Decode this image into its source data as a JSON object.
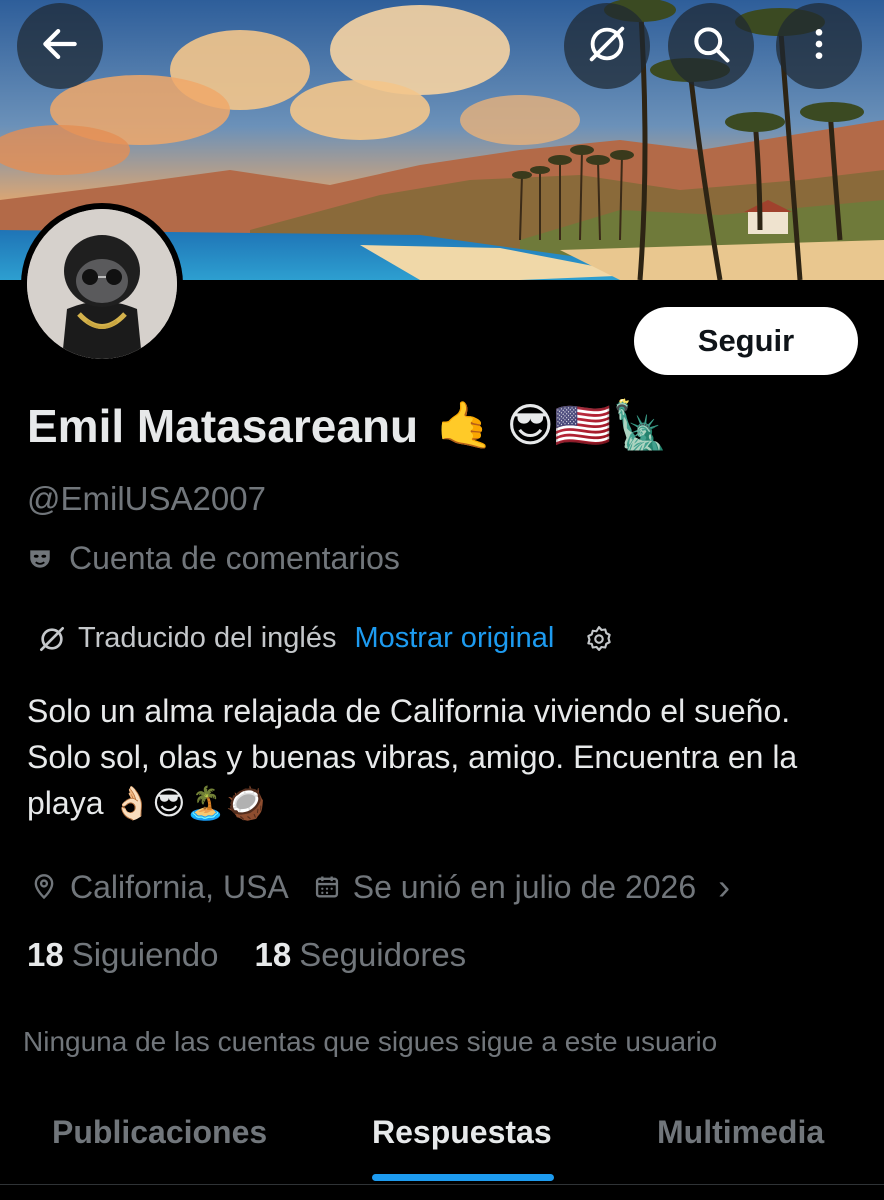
{
  "header": {
    "back_icon": "arrow-left-icon",
    "translate_icon": "translate-off-icon",
    "search_icon": "search-icon",
    "more_icon": "more-vertical-icon"
  },
  "profile": {
    "display_name": "Emil Matasareanu",
    "name_emojis": "🤙 😎🇺🇸🗽",
    "handle": "@EmilUSA2007",
    "account_label": "Cuenta de comentarios",
    "follow_label": "Seguir"
  },
  "translation": {
    "label": "Traducido del inglés",
    "show_original": "Mostrar original"
  },
  "bio": "Solo un alma relajada de California viviendo el sueño. Solo sol, olas y buenas vibras, amigo. Encuentra en la playa 👌🏻😎🏝️🥥",
  "meta": {
    "location": "California, USA",
    "joined": "Se unió en julio de 2026",
    "chevron": "›"
  },
  "stats": {
    "following_count": "18",
    "following_label": "Siguiendo",
    "followers_count": "18",
    "followers_label": "Seguidores"
  },
  "mutuals_note": "Ninguna de las cuentas que sigues sigue a este usuario",
  "tabs": [
    {
      "label": "Publicaciones"
    },
    {
      "label": "Respuestas",
      "active": true
    },
    {
      "label": "Multimedia"
    }
  ],
  "colors": {
    "accent": "#1d9bf0",
    "background": "#000000",
    "muted_text": "#71767b",
    "primary_text": "#e7e9ea"
  }
}
